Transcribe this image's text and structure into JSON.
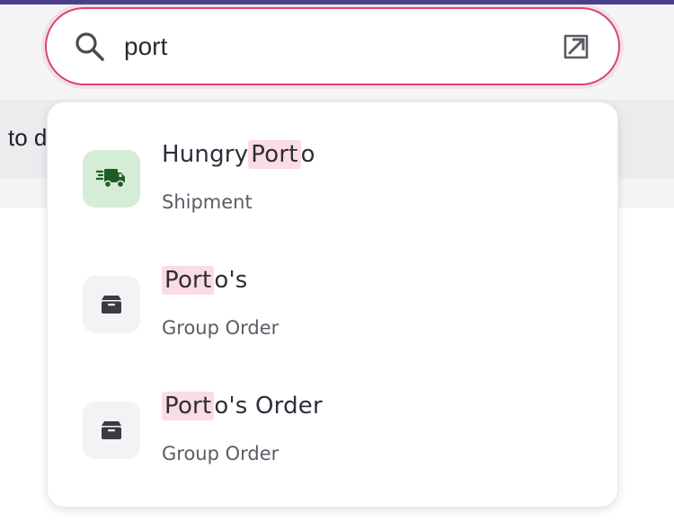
{
  "search": {
    "value": "port",
    "placeholder": ""
  },
  "background": {
    "partial_text": "to d"
  },
  "results": [
    {
      "title_before": "Hungry",
      "title_match": "Port",
      "title_after": "o",
      "subtitle": "Shipment",
      "icon": "delivery-truck-icon",
      "icon_bg": "#d5ecd6",
      "icon_color": "#1e5c23"
    },
    {
      "title_before": "",
      "title_match": "Port",
      "title_after": "o's",
      "subtitle": "Group Order",
      "icon": "box-icon",
      "icon_bg": "#f3f3f5",
      "icon_color": "#3a3a44"
    },
    {
      "title_before": "",
      "title_match": "Port",
      "title_after": "o's Order",
      "subtitle": "Group Order",
      "icon": "box-icon",
      "icon_bg": "#f3f3f5",
      "icon_color": "#3a3a44"
    }
  ],
  "colors": {
    "accent": "#d9466b",
    "highlight": "#fbdce3",
    "top_bar": "#4a3f8c"
  }
}
